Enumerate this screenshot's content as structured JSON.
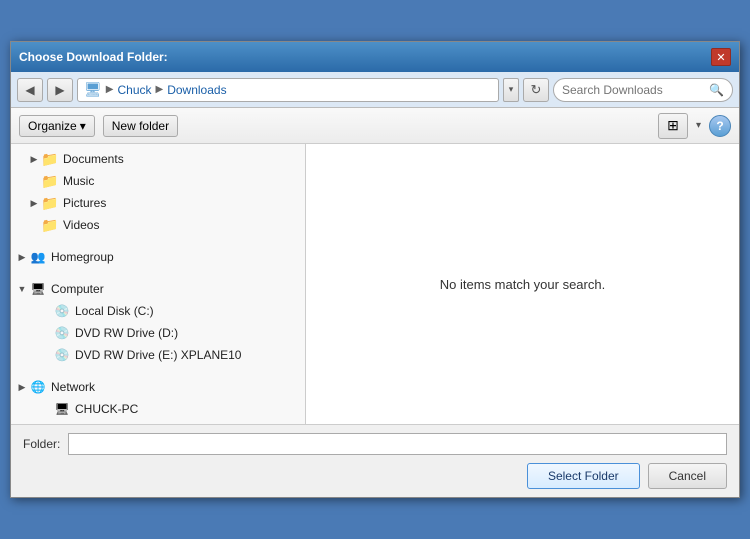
{
  "dialog": {
    "title": "Choose Download Folder:",
    "close_label": "✕"
  },
  "nav": {
    "back_label": "◀",
    "forward_label": "▶",
    "breadcrumb": [
      "Chuck",
      "Downloads"
    ],
    "refresh_label": "↻",
    "search_placeholder": "Search Downloads"
  },
  "toolbar": {
    "organize_label": "Organize",
    "organize_arrow": "▾",
    "new_folder_label": "New folder",
    "view_label": "⊞",
    "help_label": "?"
  },
  "sidebar": {
    "items": [
      {
        "id": "documents",
        "label": "Documents",
        "indent": 1,
        "toggle": "",
        "icon": "folder"
      },
      {
        "id": "music",
        "label": "Music",
        "indent": 1,
        "toggle": "",
        "icon": "folder"
      },
      {
        "id": "pictures",
        "label": "Pictures",
        "indent": 1,
        "toggle": "",
        "icon": "folder"
      },
      {
        "id": "videos",
        "label": "Videos",
        "indent": 1,
        "toggle": "",
        "icon": "folder"
      },
      {
        "id": "homegroup",
        "label": "Homegroup",
        "indent": 0,
        "toggle": "▶",
        "icon": "group"
      },
      {
        "id": "computer",
        "label": "Computer",
        "indent": 0,
        "toggle": "▼",
        "icon": "computer"
      },
      {
        "id": "local-disk",
        "label": "Local Disk (C:)",
        "indent": 2,
        "toggle": "",
        "icon": "drive"
      },
      {
        "id": "dvd-rw-d",
        "label": "DVD RW Drive (D:)",
        "indent": 2,
        "toggle": "",
        "icon": "drive"
      },
      {
        "id": "dvd-rw-e",
        "label": "DVD RW Drive (E:) XPLANE10",
        "indent": 2,
        "toggle": "",
        "icon": "drive"
      },
      {
        "id": "network",
        "label": "Network",
        "indent": 0,
        "toggle": "▶",
        "icon": "network"
      },
      {
        "id": "chuck-pc",
        "label": "CHUCK-PC",
        "indent": 2,
        "toggle": "",
        "icon": "computer"
      }
    ]
  },
  "content": {
    "empty_message": "No items match your search."
  },
  "footer": {
    "folder_label": "Folder:",
    "folder_value": "",
    "select_button": "Select Folder",
    "cancel_button": "Cancel"
  }
}
